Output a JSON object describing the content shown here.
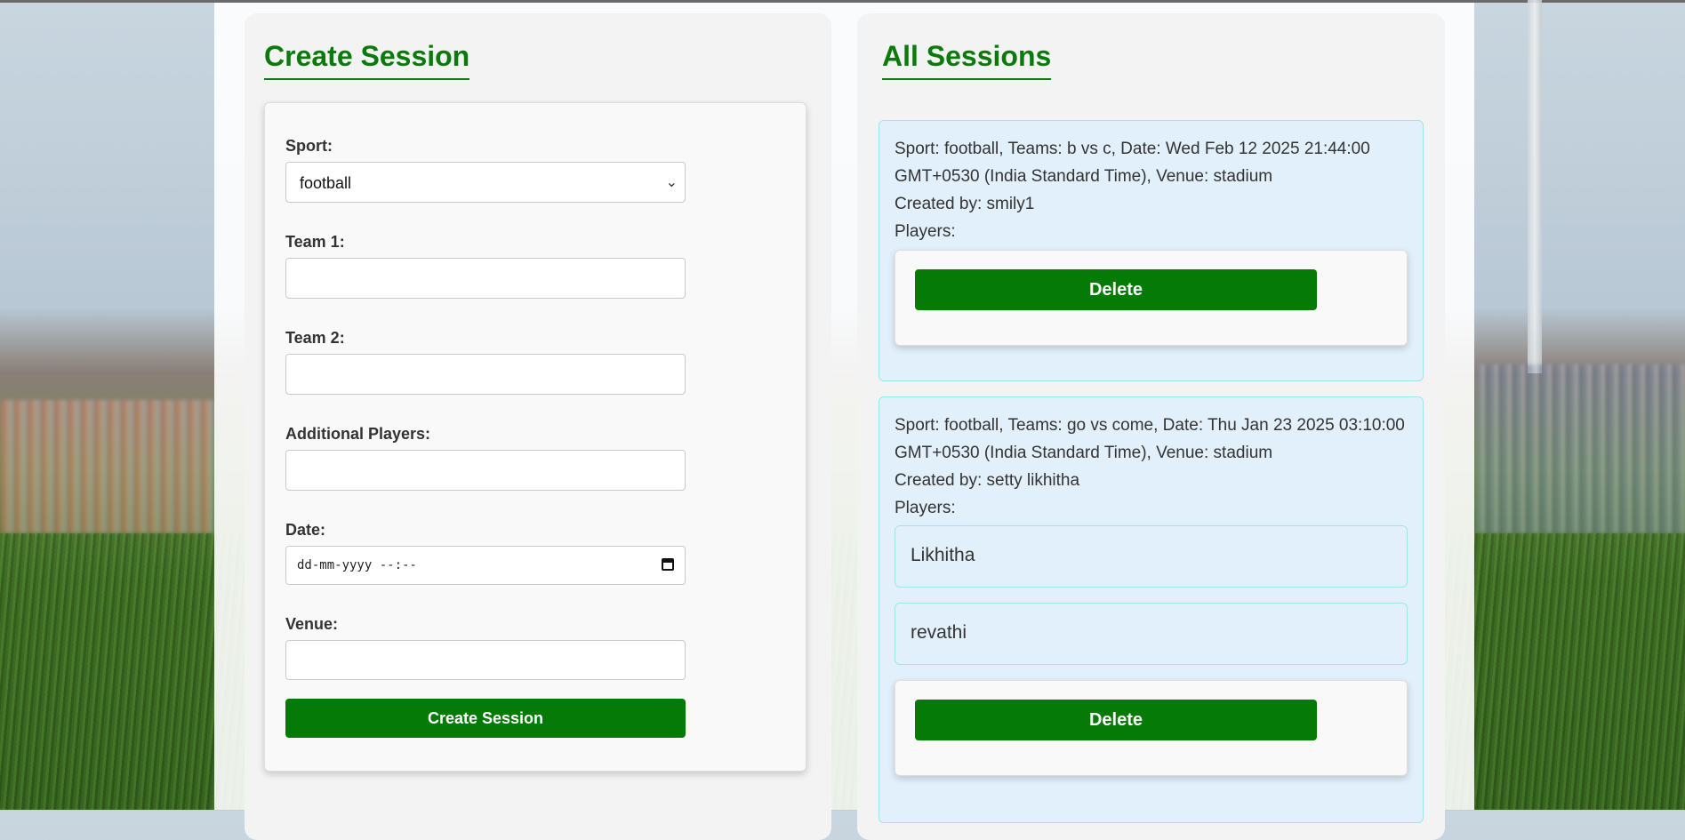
{
  "create": {
    "heading": "Create Session",
    "sport_label": "Sport:",
    "sport_value": "football",
    "team1_label": "Team 1:",
    "team1_value": "",
    "team2_label": "Team 2:",
    "team2_value": "",
    "players_label": "Additional Players:",
    "players_value": "",
    "date_label": "Date:",
    "date_placeholder": "dd-mm-yyyy --:--",
    "venue_label": "Venue:",
    "venue_value": "",
    "submit_label": "Create Session"
  },
  "sessions": {
    "heading": "All Sessions",
    "items": [
      {
        "summary": "Sport: football, Teams: b vs c, Date: Wed Feb 12 2025 21:44:00 GMT+0530 (India Standard Time), Venue: stadium",
        "created_by": "Created by: smily1",
        "players_label": "Players:",
        "players": [],
        "delete_label": "Delete"
      },
      {
        "summary": "Sport: football, Teams: go vs come, Date: Thu Jan 23 2025 03:10:00 GMT+0530 (India Standard Time), Venue: stadium",
        "created_by": "Created by: setty likhitha",
        "players_label": "Players:",
        "players": [
          "Likhitha",
          "revathi"
        ],
        "delete_label": "Delete"
      }
    ]
  },
  "colors": {
    "accent": "#067a06",
    "session_bg": "#e2f0fb",
    "session_border": "#9ee6e6"
  },
  "icons": {
    "select": "chevron-down-icon",
    "date": "calendar-icon"
  }
}
